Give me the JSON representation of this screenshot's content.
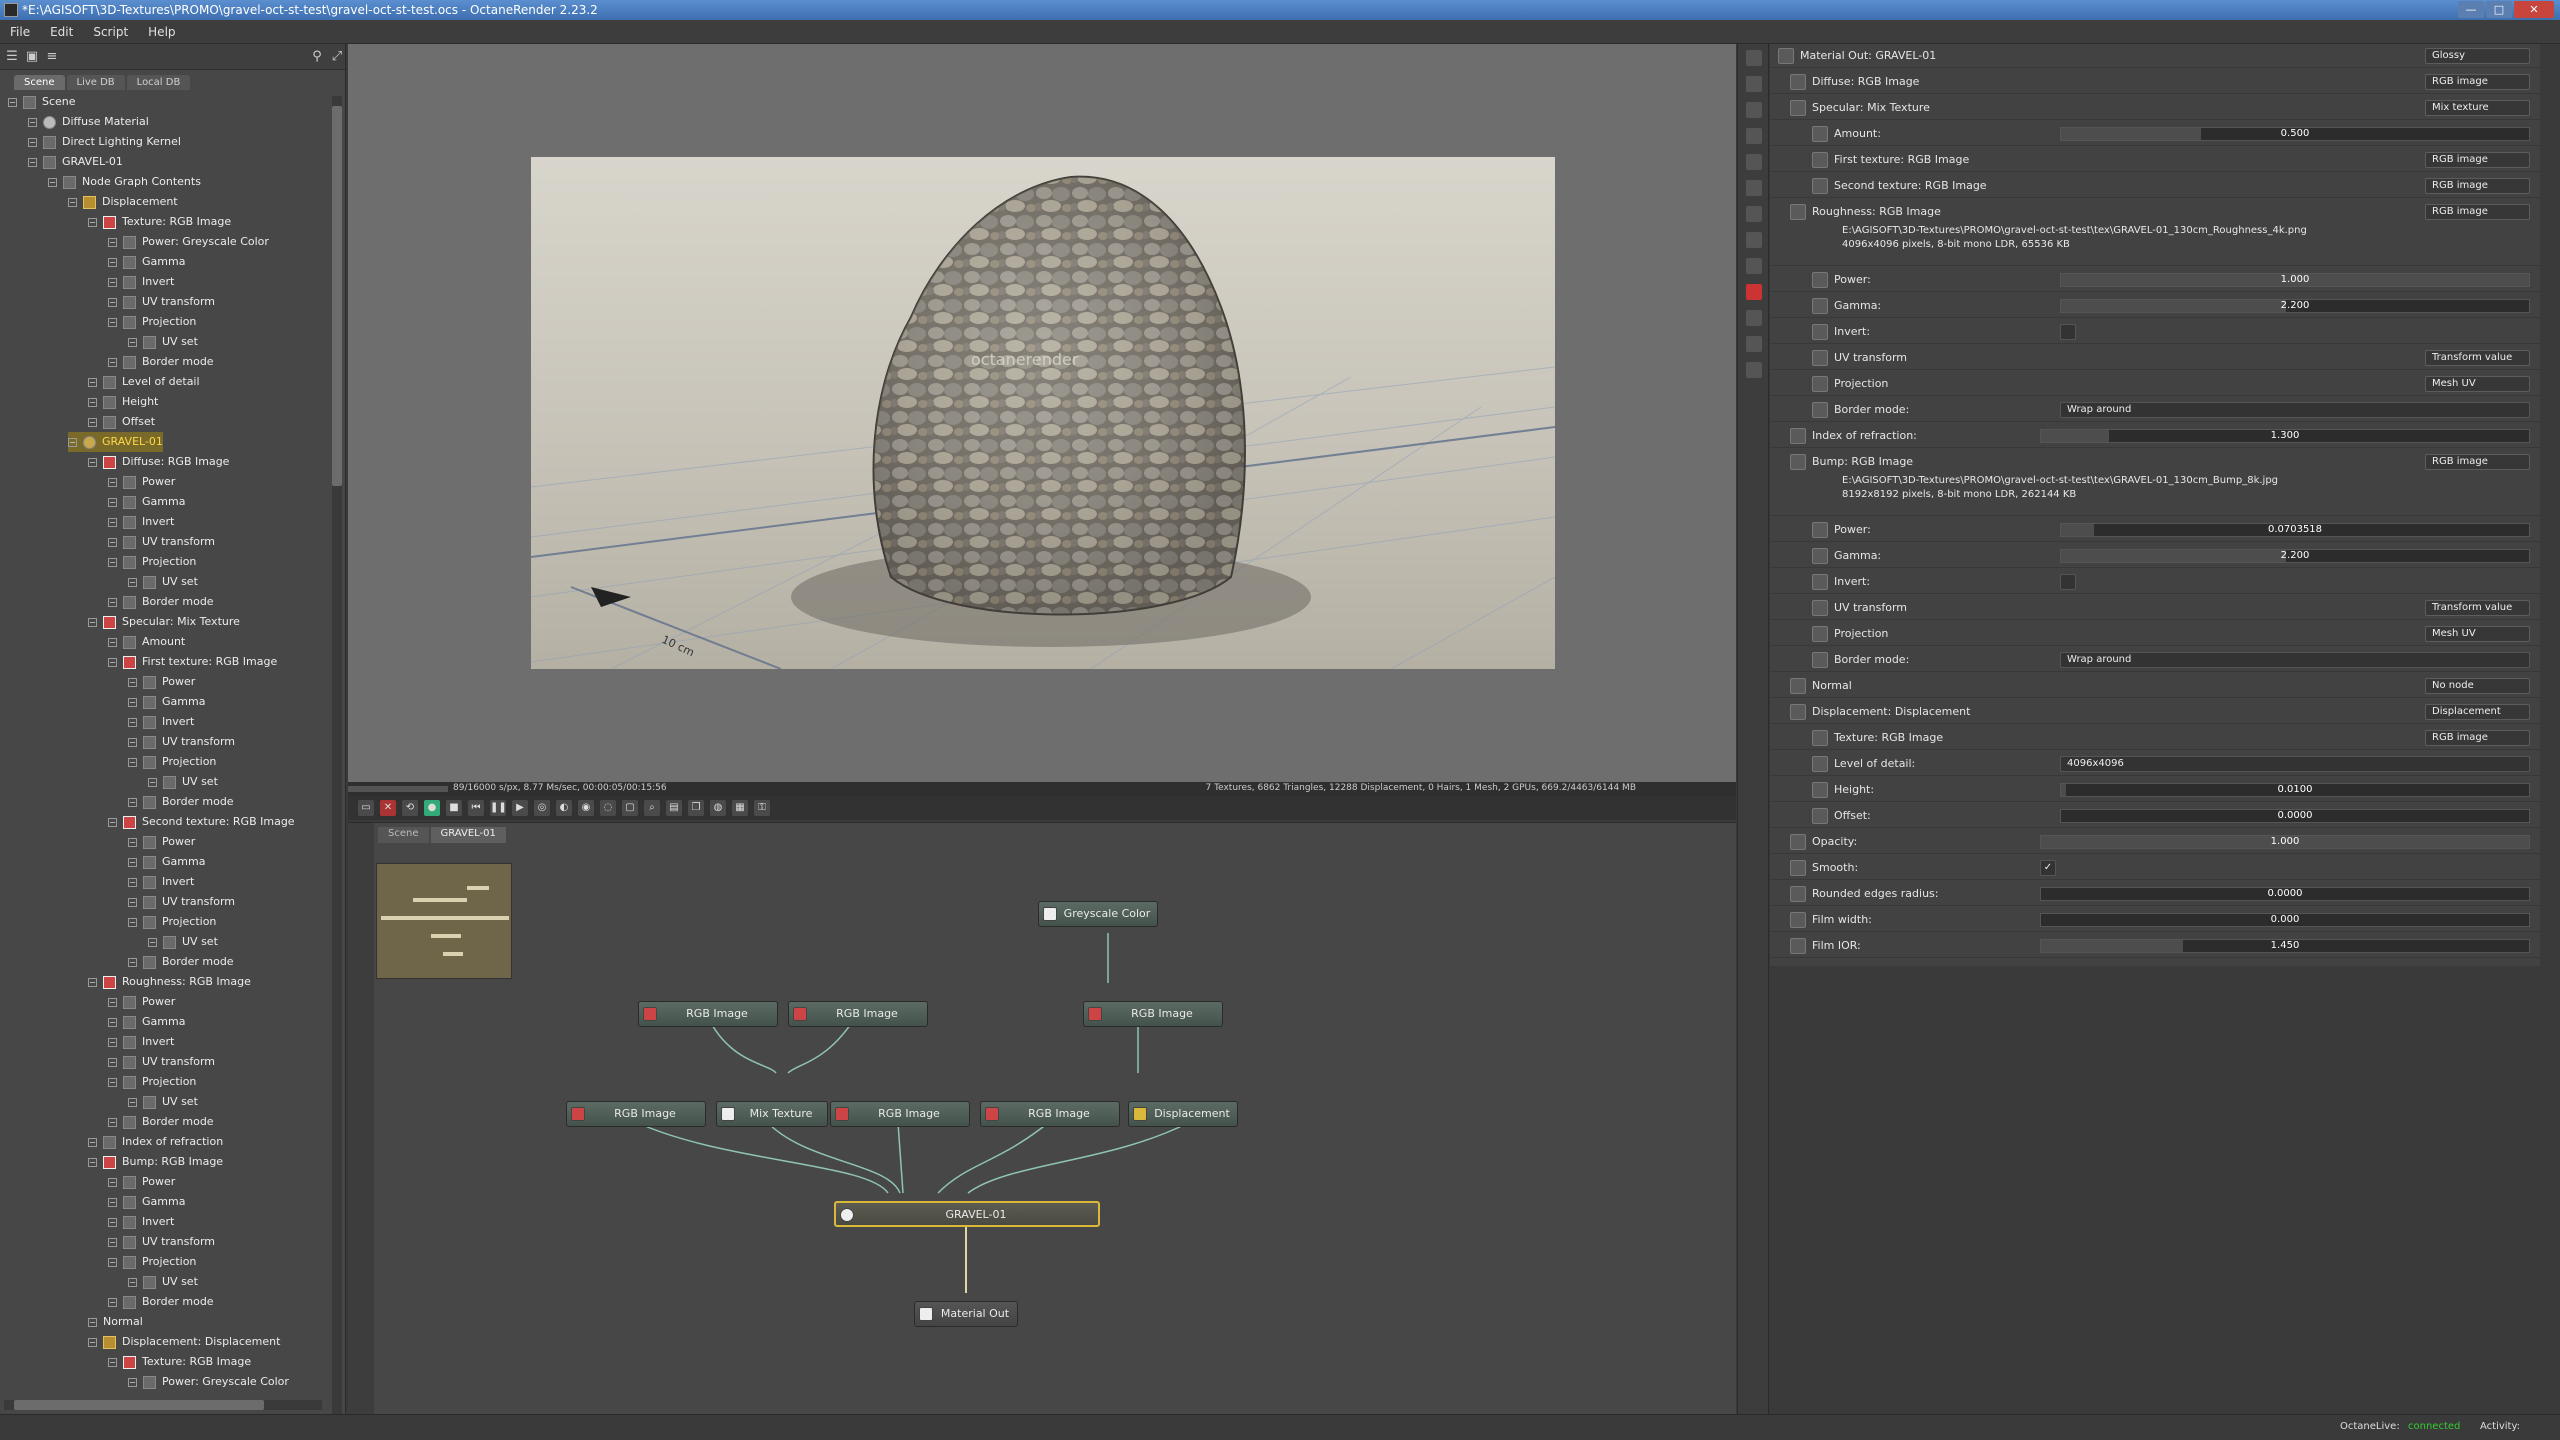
{
  "window": {
    "title": "*E:\\AGISOFT\\3D-Textures\\PROMO\\gravel-oct-st-test\\gravel-oct-st-test.ocs - OctaneRender 2.23.2",
    "minimize": "—",
    "maximize": "□",
    "close": "✕"
  },
  "menu": [
    "File",
    "Edit",
    "Script",
    "Help"
  ],
  "left_panel": {
    "tabs": [
      "Scene",
      "Live DB",
      "Local DB"
    ],
    "tree": [
      {
        "label": "Scene",
        "depth": 0,
        "icon": "scene-icon"
      },
      {
        "label": "Diffuse Material",
        "depth": 1,
        "icon": "material-icon"
      },
      {
        "label": "Direct Lighting Kernel",
        "depth": 1,
        "icon": "kernel-icon"
      },
      {
        "label": "GRAVEL-01",
        "depth": 1,
        "icon": "graph-icon"
      },
      {
        "label": "Node Graph Contents",
        "depth": 2,
        "icon": "graph-icon"
      },
      {
        "label": "Displacement",
        "depth": 3,
        "icon": "folder-icon"
      },
      {
        "label": "Texture: RGB Image",
        "depth": 4,
        "icon": "texture-icon"
      },
      {
        "label": "Power: Greyscale Color",
        "depth": 5,
        "icon": "value-icon"
      },
      {
        "label": "Gamma",
        "depth": 5,
        "icon": "value-icon"
      },
      {
        "label": "Invert",
        "depth": 5,
        "icon": "value-icon"
      },
      {
        "label": "UV transform",
        "depth": 5,
        "icon": "transform-icon"
      },
      {
        "label": "Projection",
        "depth": 5,
        "icon": "value-icon"
      },
      {
        "label": "UV set",
        "depth": 6,
        "icon": "value-icon"
      },
      {
        "label": "Border mode",
        "depth": 5,
        "icon": "value-icon"
      },
      {
        "label": "Level of detail",
        "depth": 4,
        "icon": "value-icon"
      },
      {
        "label": "Height",
        "depth": 4,
        "icon": "value-icon"
      },
      {
        "label": "Offset",
        "depth": 4,
        "icon": "value-icon"
      },
      {
        "label": "GRAVEL-01",
        "depth": 3,
        "icon": "material-icon",
        "selected": true
      },
      {
        "label": "Diffuse: RGB Image",
        "depth": 4,
        "icon": "texture-icon"
      },
      {
        "label": "Power",
        "depth": 5,
        "icon": "value-icon"
      },
      {
        "label": "Gamma",
        "depth": 5,
        "icon": "value-icon"
      },
      {
        "label": "Invert",
        "depth": 5,
        "icon": "value-icon"
      },
      {
        "label": "UV transform",
        "depth": 5,
        "icon": "transform-icon"
      },
      {
        "label": "Projection",
        "depth": 5,
        "icon": "value-icon"
      },
      {
        "label": "UV set",
        "depth": 6,
        "icon": "value-icon"
      },
      {
        "label": "Border mode",
        "depth": 5,
        "icon": "value-icon"
      },
      {
        "label": "Specular: Mix Texture",
        "depth": 4,
        "icon": "texture-icon"
      },
      {
        "label": "Amount",
        "depth": 5,
        "icon": "value-icon"
      },
      {
        "label": "First texture: RGB Image",
        "depth": 5,
        "icon": "texture-icon"
      },
      {
        "label": "Power",
        "depth": 6,
        "icon": "value-icon"
      },
      {
        "label": "Gamma",
        "depth": 6,
        "icon": "value-icon"
      },
      {
        "label": "Invert",
        "depth": 6,
        "icon": "value-icon"
      },
      {
        "label": "UV transform",
        "depth": 6,
        "icon": "transform-icon"
      },
      {
        "label": "Projection",
        "depth": 6,
        "icon": "value-icon"
      },
      {
        "label": "UV set",
        "depth": 7,
        "icon": "value-icon"
      },
      {
        "label": "Border mode",
        "depth": 6,
        "icon": "value-icon"
      },
      {
        "label": "Second texture: RGB Image",
        "depth": 5,
        "icon": "texture-icon"
      },
      {
        "label": "Power",
        "depth": 6,
        "icon": "value-icon"
      },
      {
        "label": "Gamma",
        "depth": 6,
        "icon": "value-icon"
      },
      {
        "label": "Invert",
        "depth": 6,
        "icon": "value-icon"
      },
      {
        "label": "UV transform",
        "depth": 6,
        "icon": "transform-icon"
      },
      {
        "label": "Projection",
        "depth": 6,
        "icon": "value-icon"
      },
      {
        "label": "UV set",
        "depth": 7,
        "icon": "value-icon"
      },
      {
        "label": "Border mode",
        "depth": 6,
        "icon": "value-icon"
      },
      {
        "label": "Roughness: RGB Image",
        "depth": 4,
        "icon": "texture-icon"
      },
      {
        "label": "Power",
        "depth": 5,
        "icon": "value-icon"
      },
      {
        "label": "Gamma",
        "depth": 5,
        "icon": "value-icon"
      },
      {
        "label": "Invert",
        "depth": 5,
        "icon": "value-icon"
      },
      {
        "label": "UV transform",
        "depth": 5,
        "icon": "transform-icon"
      },
      {
        "label": "Projection",
        "depth": 5,
        "icon": "value-icon"
      },
      {
        "label": "UV set",
        "depth": 6,
        "icon": "value-icon"
      },
      {
        "label": "Border mode",
        "depth": 5,
        "icon": "value-icon"
      },
      {
        "label": "Index of refraction",
        "depth": 4,
        "icon": "value-icon"
      },
      {
        "label": "Bump: RGB Image",
        "depth": 4,
        "icon": "texture-icon"
      },
      {
        "label": "Power",
        "depth": 5,
        "icon": "value-icon"
      },
      {
        "label": "Gamma",
        "depth": 5,
        "icon": "value-icon"
      },
      {
        "label": "Invert",
        "depth": 5,
        "icon": "value-icon"
      },
      {
        "label": "UV transform",
        "depth": 5,
        "icon": "transform-icon"
      },
      {
        "label": "Projection",
        "depth": 5,
        "icon": "value-icon"
      },
      {
        "label": "UV set",
        "depth": 6,
        "icon": "value-icon"
      },
      {
        "label": "Border mode",
        "depth": 5,
        "icon": "value-icon"
      },
      {
        "label": "Normal",
        "depth": 4,
        "icon": "none"
      },
      {
        "label": "Displacement: Displacement",
        "depth": 4,
        "icon": "folder-icon"
      },
      {
        "label": "Texture: RGB Image",
        "depth": 5,
        "icon": "texture-icon"
      },
      {
        "label": "Power: Greyscale Color",
        "depth": 6,
        "icon": "value-icon"
      }
    ]
  },
  "viewport": {
    "render_status_left": "89/16000 s/px, 8.77 Ms/sec, 00:00:05/00:15:56",
    "render_status_right": "7 Textures, 6862 Triangles, 12288 Displacement, 0 Hairs, 1 Mesh, 2 GPUs, 669.2/4463/6144 MB",
    "watermark": "octanerender",
    "ruler_label": "10 cm"
  },
  "graph": {
    "tabs": [
      "Scene",
      "GRAVEL-01"
    ],
    "nodes": {
      "greyscale": "Greyscale Color",
      "rgb1": "RGB Image",
      "rgb2": "RGB Image",
      "rgb3": "RGB Image",
      "rgb4": "RGB Image",
      "mix": "Mix Texture",
      "rgb5": "RGB Image",
      "rgb6": "RGB Image",
      "displacement": "Displacement",
      "material": "GRAVEL-01",
      "out": "Material Out"
    }
  },
  "props": {
    "header": {
      "label": "Material Out: GRAVEL-01",
      "type": "Glossy"
    },
    "diffuse": {
      "label": "Diffuse: RGB Image",
      "type": "RGB image"
    },
    "specular": {
      "label": "Specular: Mix Texture",
      "type": "Mix texture"
    },
    "amount": {
      "label": "Amount:",
      "value": "0.500"
    },
    "first_texture": {
      "label": "First texture: RGB Image",
      "type": "RGB image"
    },
    "second_texture": {
      "label": "Second texture: RGB Image",
      "type": "RGB image"
    },
    "roughness": {
      "label": "Roughness: RGB Image",
      "type": "RGB image",
      "path": "E:\\AGISOFT\\3D-Textures\\PROMO\\gravel-oct-st-test\\tex\\GRAVEL-01_130cm_Roughness_4k.png",
      "info": "4096x4096 pixels, 8-bit mono LDR, 65536 KB"
    },
    "r_power": {
      "label": "Power:",
      "value": "1.000"
    },
    "r_gamma": {
      "label": "Gamma:",
      "value": "2.200"
    },
    "r_invert": {
      "label": "Invert:"
    },
    "r_uv": {
      "label": "UV transform",
      "type": "Transform value"
    },
    "r_proj": {
      "label": "Projection",
      "type": "Mesh UV"
    },
    "r_border": {
      "label": "Border mode:",
      "value": "Wrap around"
    },
    "ior": {
      "label": "Index of refraction:",
      "value": "1.300"
    },
    "bump": {
      "label": "Bump: RGB Image",
      "type": "RGB image",
      "path": "E:\\AGISOFT\\3D-Textures\\PROMO\\gravel-oct-st-test\\tex\\GRAVEL-01_130cm_Bump_8k.jpg",
      "info": "8192x8192 pixels, 8-bit mono LDR, 262144 KB"
    },
    "b_power": {
      "label": "Power:",
      "value": "0.0703518"
    },
    "b_gamma": {
      "label": "Gamma:",
      "value": "2.200"
    },
    "b_invert": {
      "label": "Invert:"
    },
    "b_uv": {
      "label": "UV transform",
      "type": "Transform value"
    },
    "b_proj": {
      "label": "Projection",
      "type": "Mesh UV"
    },
    "b_border": {
      "label": "Border mode:",
      "value": "Wrap around"
    },
    "normal": {
      "label": "Normal",
      "type": "No node"
    },
    "displacement": {
      "label": "Displacement: Displacement",
      "type": "Displacement"
    },
    "d_texture": {
      "label": "Texture: RGB Image",
      "type": "RGB image"
    },
    "d_lod": {
      "label": "Level of detail:",
      "value": "4096x4096"
    },
    "d_height": {
      "label": "Height:",
      "value": "0.0100"
    },
    "d_offset": {
      "label": "Offset:",
      "value": "0.0000"
    },
    "opacity": {
      "label": "Opacity:",
      "value": "1.000"
    },
    "smooth": {
      "label": "Smooth:",
      "value": "✓"
    },
    "rounded": {
      "label": "Rounded edges radius:",
      "value": "0.0000"
    },
    "film_width": {
      "label": "Film width:",
      "value": "0.000"
    },
    "film_ior": {
      "label": "Film IOR:",
      "value": "1.450"
    }
  },
  "status": {
    "live_label": "OctaneLive:",
    "live_value": "connected",
    "activity_label": "Activity:"
  },
  "colors": {
    "connected": "#33cc33",
    "selection": "#d9b83a",
    "accent": "#3d6fb0"
  }
}
